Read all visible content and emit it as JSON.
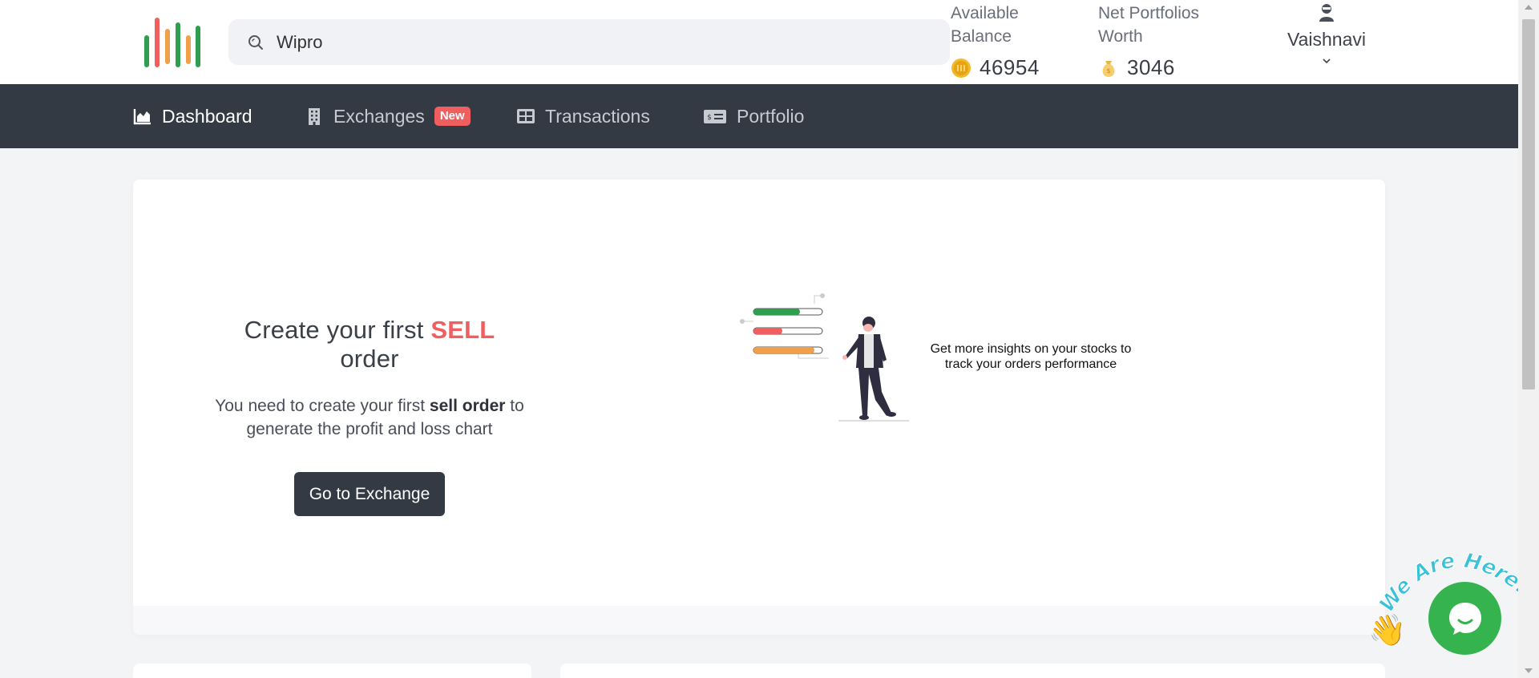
{
  "search": {
    "value": "Wipro"
  },
  "stats": {
    "balance_label": "Available Balance",
    "balance_value": "46954",
    "worth_label": "Net Portfolios Worth",
    "worth_value": "3046"
  },
  "user": {
    "name": "Vaishnavi"
  },
  "nav": {
    "items": [
      {
        "label": "Dashboard",
        "icon": "chart-area-icon",
        "active": true
      },
      {
        "label": "Exchanges",
        "icon": "building-icon",
        "badge": "New"
      },
      {
        "label": "Transactions",
        "icon": "table-icon"
      },
      {
        "label": "Portfolio",
        "icon": "money-check-icon"
      }
    ]
  },
  "card": {
    "title_pre": "Create your first",
    "title_emph": "SELL",
    "title_post": "order",
    "desc_pre": "You need to create your first",
    "desc_bold": "sell order",
    "desc_post": "to generate the profit and loss chart",
    "button_label": "Go to Exchange",
    "insight": "Get more insights on your stocks to track your orders performance"
  },
  "chat": {
    "banner": "We Are Here!"
  },
  "colors": {
    "nav_bg": "#343a43",
    "accent_red": "#ef5f5f",
    "chat_green": "#34b34f",
    "logo_green": "#2e9e4f",
    "logo_orange": "#f0a04b",
    "logo_red": "#ef5f5f"
  }
}
